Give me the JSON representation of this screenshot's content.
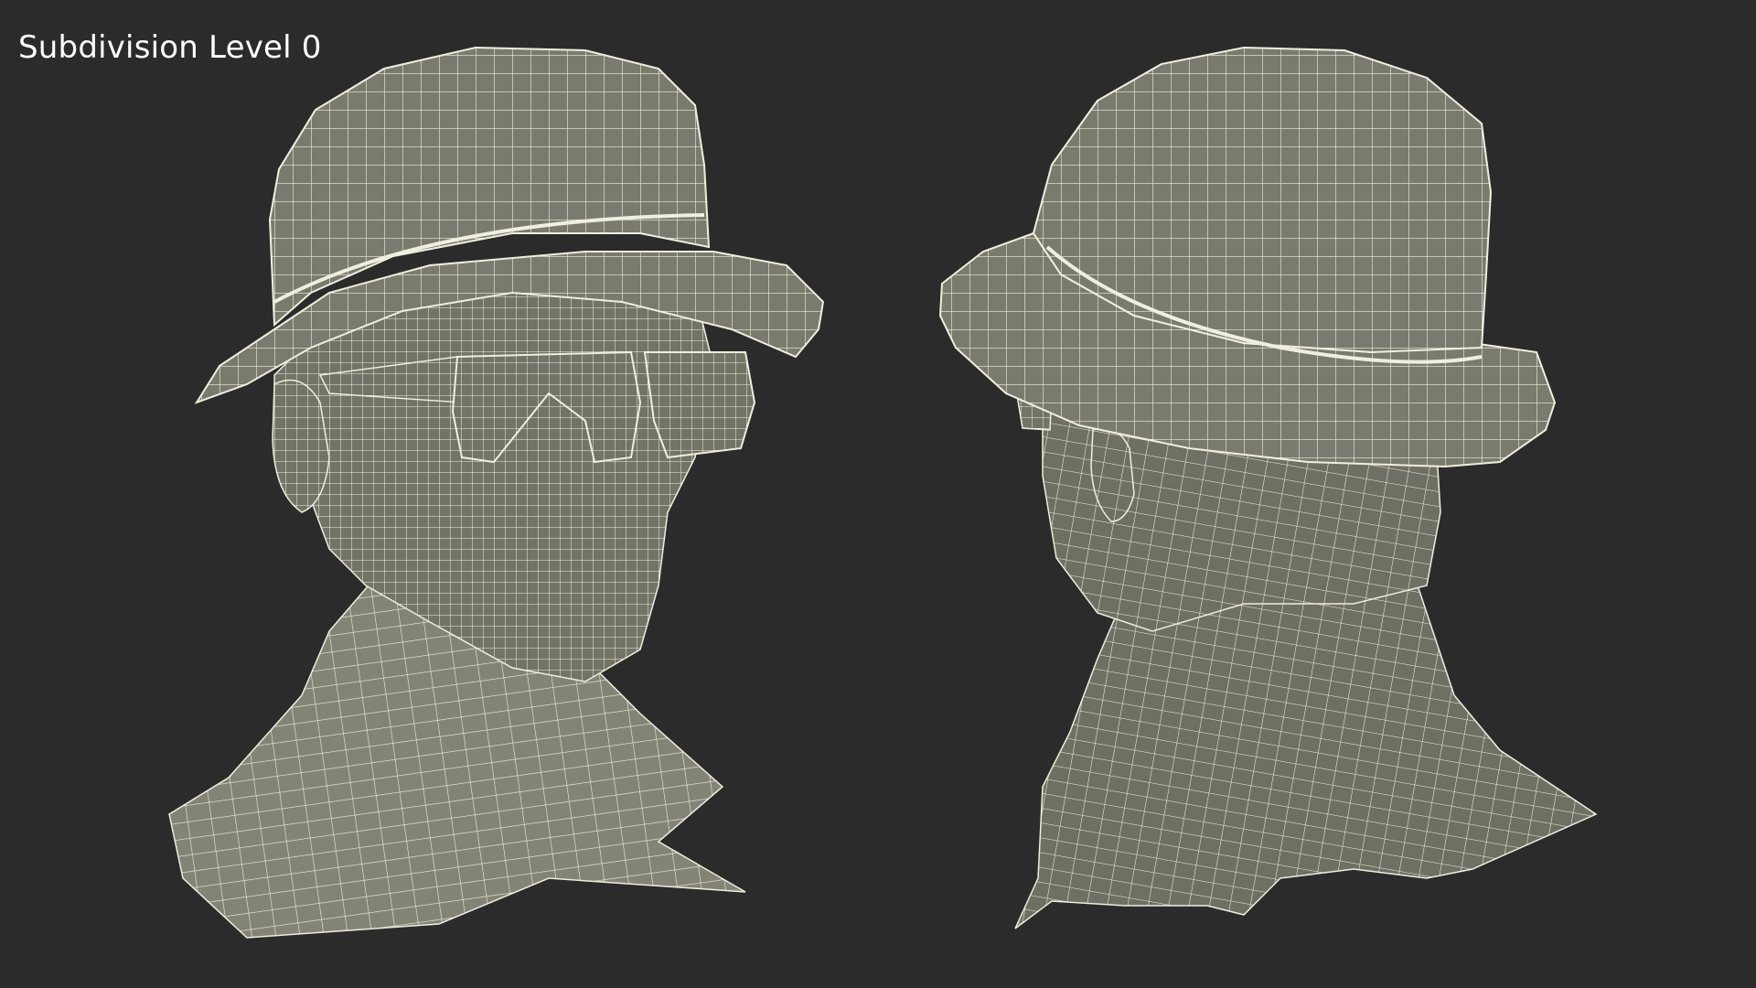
{
  "viewport": {
    "label": "Subdivision Level 0"
  },
  "render": {
    "background_color": "#2b2b2b",
    "mesh_fill_color": "#7a7b6e",
    "wire_color": "#f0eedf",
    "views": [
      "front-three-quarter",
      "rear-three-quarter"
    ]
  }
}
